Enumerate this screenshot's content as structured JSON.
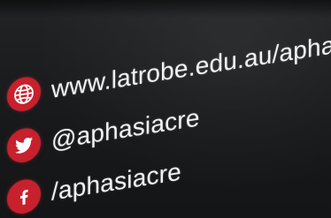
{
  "contacts": [
    {
      "icon": "globe-icon",
      "text": "www.latrobe.edu.au/aphasiacre"
    },
    {
      "icon": "twitter-bird-icon",
      "text": "@aphasiacre"
    },
    {
      "icon": "facebook-f-icon",
      "text": "/aphasiacre"
    }
  ],
  "colors": {
    "background": "#1b1c1e",
    "icon_circle": "#c8202d",
    "text": "#f2f2f2"
  }
}
